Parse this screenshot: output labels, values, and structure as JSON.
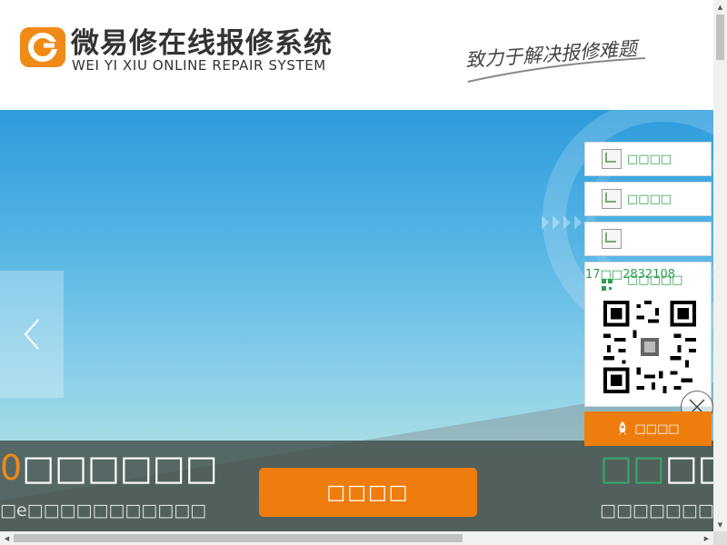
{
  "header": {
    "title": "微易修在线报修系统",
    "subtitle": "WEI YI XIU ONLINE REPAIR SYSTEM",
    "slogan": "致力于解决报修难题"
  },
  "banner": {
    "left_big_orange": "0",
    "left_big_rest": "□□□□□□",
    "left_small": "□e□□□□□□□□□□□",
    "right_big_green": "□□",
    "right_big_rest": "□□□",
    "right_small": "□□□□□□□e□□□",
    "cta_label": "□□□□",
    "prev_icon": "chevron-left-icon"
  },
  "side_panel": {
    "item1_label": "□□□□",
    "item2_label": "□□□□",
    "item3_label": "",
    "phone": "17□□2832108",
    "qr_label": "□□□□□",
    "online_label": "□□□□"
  },
  "colors": {
    "brand_orange": "#ef7d0e",
    "accent_green": "#2c9e4f",
    "banner_blue": "#2d9cdb"
  }
}
